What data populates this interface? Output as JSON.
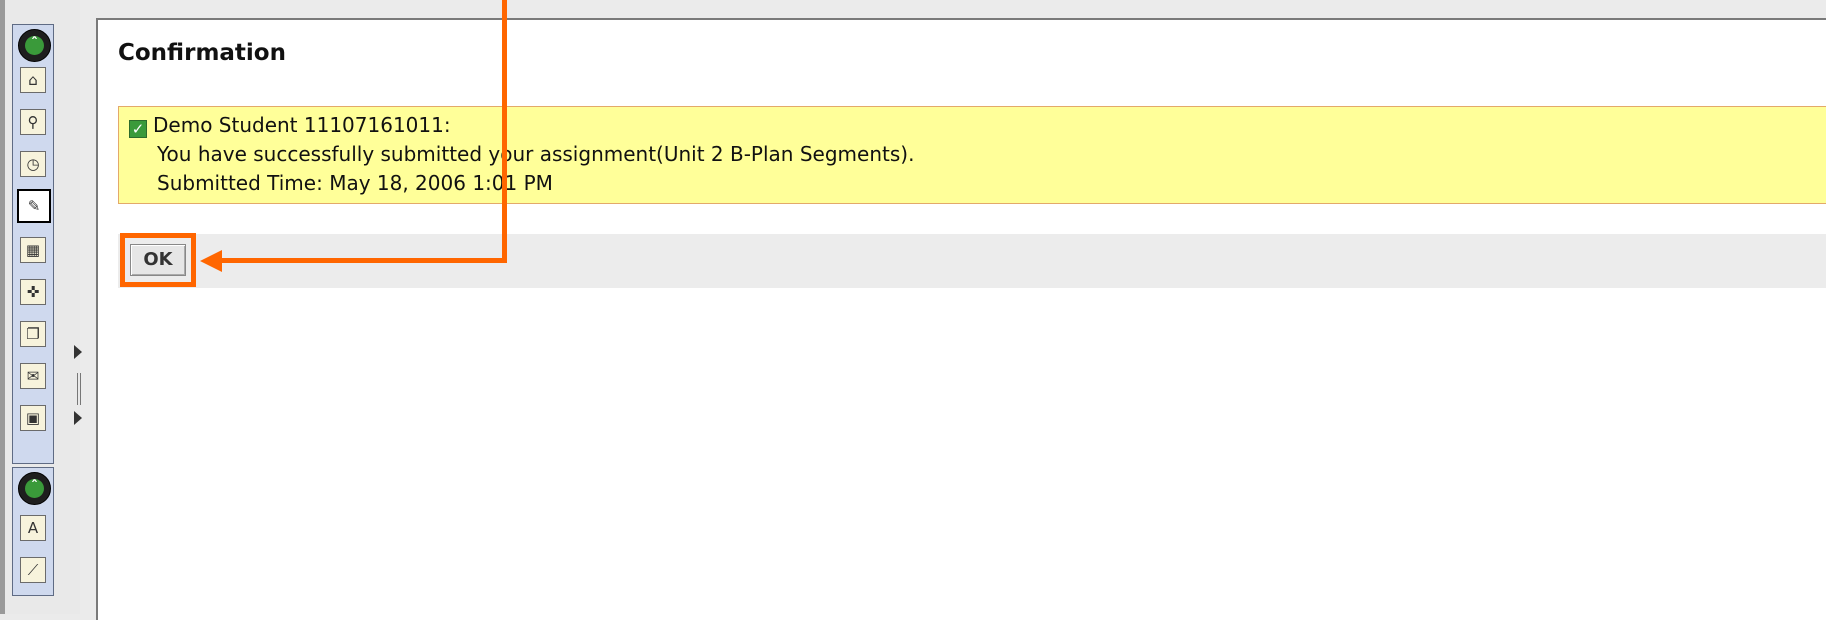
{
  "sidebar": {
    "group1": {
      "collapse_icon": "chevron-up-icon",
      "tools": [
        {
          "name": "home-icon",
          "glyph": "⌂"
        },
        {
          "name": "satellite-icon",
          "glyph": "⚲"
        },
        {
          "name": "clock-document-icon",
          "glyph": "◷"
        },
        {
          "name": "assignment-icon",
          "glyph": "✎",
          "active": true
        },
        {
          "name": "calendar-icon",
          "glyph": "▦"
        },
        {
          "name": "pushpin-icon",
          "glyph": "✜"
        },
        {
          "name": "documents-icon",
          "glyph": "❐"
        },
        {
          "name": "mail-icon",
          "glyph": "✉"
        },
        {
          "name": "presentation-icon",
          "glyph": "▣"
        }
      ]
    },
    "group2": {
      "collapse_icon": "chevron-up-icon",
      "tools": [
        {
          "name": "grade-icon",
          "glyph": "A"
        },
        {
          "name": "chart-icon",
          "glyph": "⟋"
        }
      ]
    }
  },
  "page": {
    "title": "Confirmation"
  },
  "receipt": {
    "student": "Demo Student 11107161011:",
    "message": "You have successfully submitted your assignment(Unit 2 B-Plan Segments).",
    "submitted_time": "Submitted Time: May 18, 2006 1:01 PM"
  },
  "actions": {
    "ok_label": "OK"
  },
  "colors": {
    "highlight": "#ff6600",
    "receipt_bg": "#ffff99"
  }
}
